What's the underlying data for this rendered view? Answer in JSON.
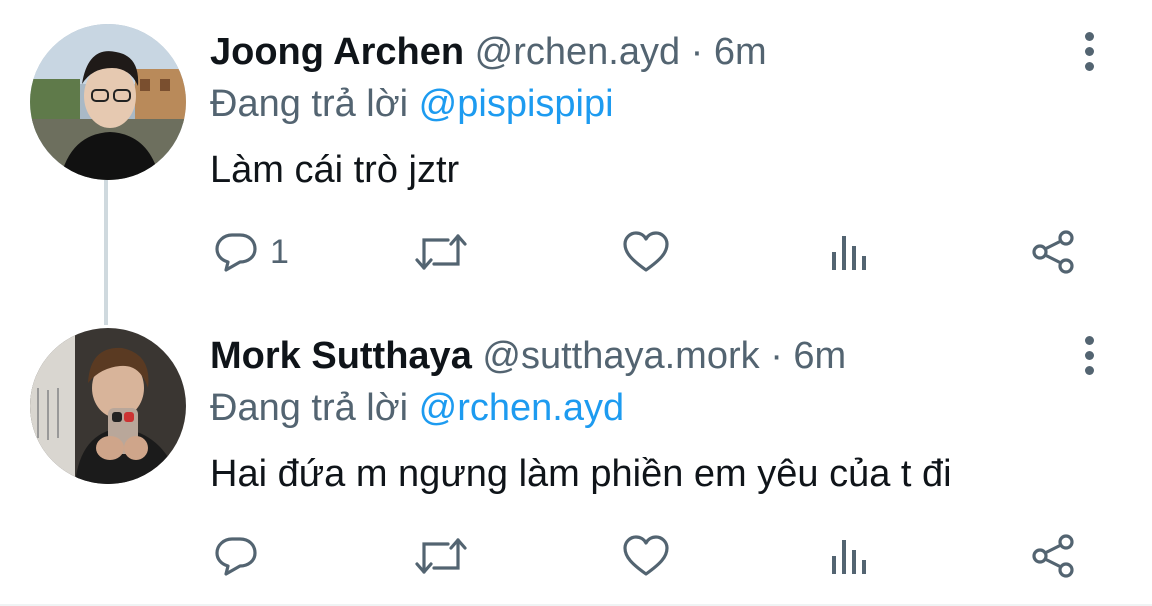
{
  "tweets": [
    {
      "name": "Joong Archen",
      "handle": "@rchen.ayd",
      "separator": "·",
      "time": "6m",
      "replying_prefix": "Đang trả lời",
      "replying_to": "@pispispipi",
      "text": "Làm cái trò jztr",
      "reply_count": "1"
    },
    {
      "name": "Mork Sutthaya",
      "handle": "@sutthaya.mork",
      "separator": "·",
      "time": "6m",
      "replying_prefix": "Đang trả lời",
      "replying_to": "@rchen.ayd",
      "text": "Hai đứa m ngưng làm phiền em yêu của t đi",
      "reply_count": ""
    }
  ],
  "icons": {
    "reply": "reply-icon",
    "retweet": "retweet-icon",
    "like": "like-icon",
    "views": "views-icon",
    "share": "share-icon",
    "more": "more-vertical-icon"
  },
  "colors": {
    "text": "#0f1419",
    "secondary": "#536471",
    "accent": "#1d9bf0",
    "thread_line": "#cfd9de"
  }
}
